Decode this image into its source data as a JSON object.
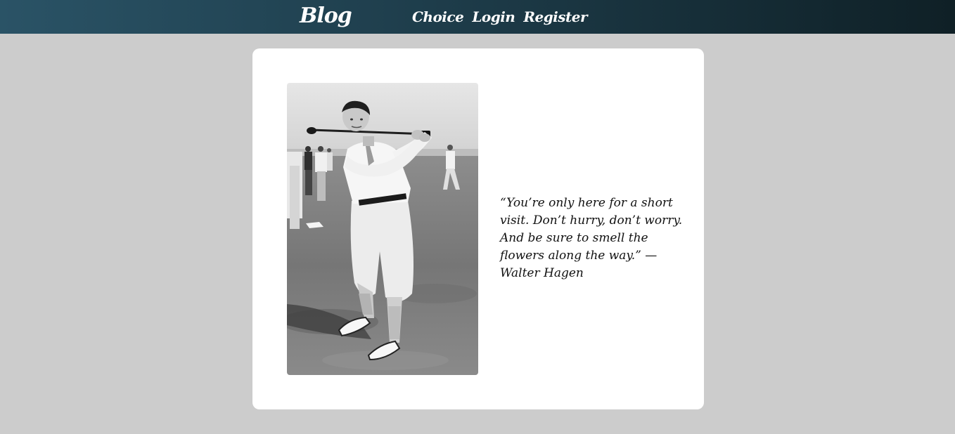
{
  "navbar": {
    "brand": "Blog",
    "links": [
      {
        "label": "Choice"
      },
      {
        "label": "Login"
      },
      {
        "label": "Register"
      }
    ]
  },
  "main": {
    "photo": {
      "alt": "Walter Hagen"
    },
    "quote": "“You’re only here for a short visit. Don’t hurry, don’t worry. And be sure to smell the flowers along the way.” —Walter Hagen"
  }
}
